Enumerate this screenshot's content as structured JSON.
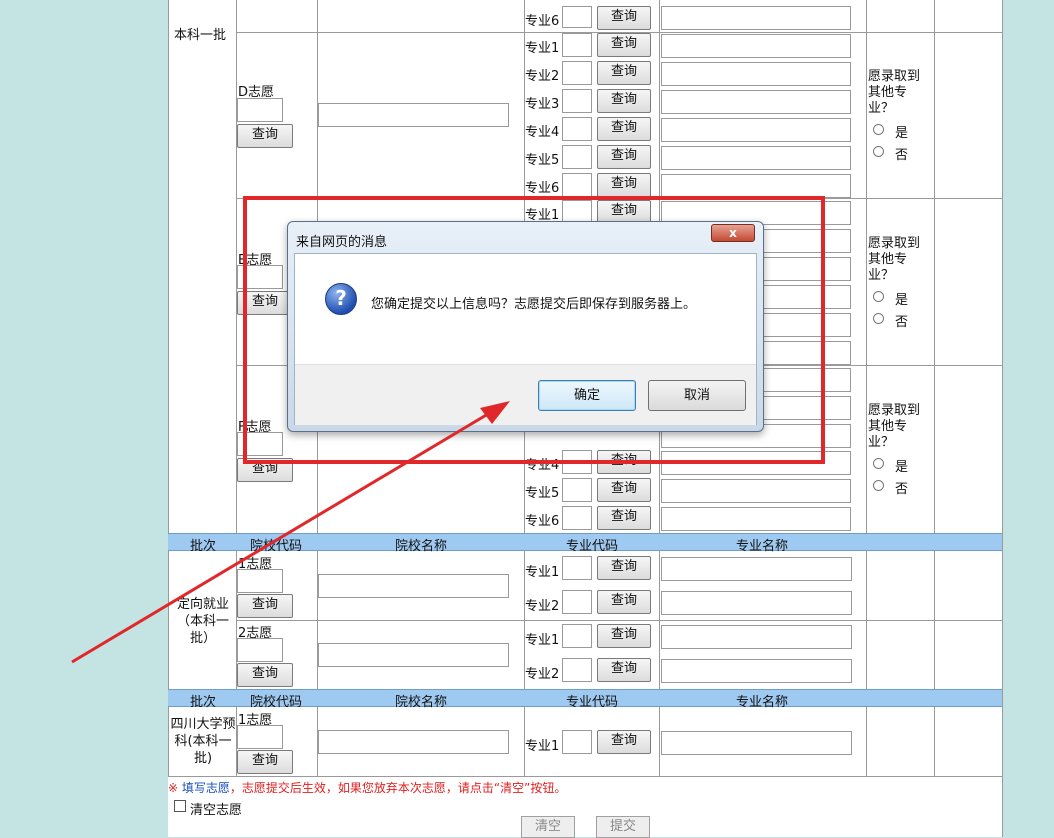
{
  "section1": {
    "batch_label": "本科一批",
    "wish_d_label": "D志愿",
    "wish_e_label": "E志愿",
    "wish_f_label": "F志愿",
    "query_label": "查询",
    "major_labels": [
      "专业1",
      "专业2",
      "专业3",
      "专业4",
      "专业5",
      "专业6"
    ],
    "transfer_question": "愿录取到其他专业？",
    "yes_label": "是",
    "no_label": "否"
  },
  "header_row": {
    "batch": "批次",
    "school_code": "院校代码",
    "school_name": "院校名称",
    "major_code": "专业代码",
    "major_name": "专业名称"
  },
  "section2": {
    "batch_label": "定向就业（本科一批）",
    "wish1_label": "1志愿",
    "wish2_label": "2志愿"
  },
  "section3": {
    "batch_label": "四川大学预科(本科一批)",
    "wish1_label": "1志愿"
  },
  "notice": {
    "mark": "※",
    "link": "填写志愿",
    "text": "，志愿提交后生效，如果您放弃本次志愿，请点击“清空”按钮。"
  },
  "clear_checkbox_label": "清空志愿",
  "buttons": {
    "clear": "清空",
    "submit": "提交"
  },
  "dialog": {
    "title": "来自网页的消息",
    "close": "x",
    "icon": "question-icon",
    "message": "您确定提交以上信息吗？志愿提交后即保存到服务器上。",
    "ok": "确定",
    "cancel": "取消"
  },
  "colors": {
    "header_blue": "#9ec9f0",
    "annotation_red": "#e0282a",
    "page_bg": "#c4e4e4"
  }
}
